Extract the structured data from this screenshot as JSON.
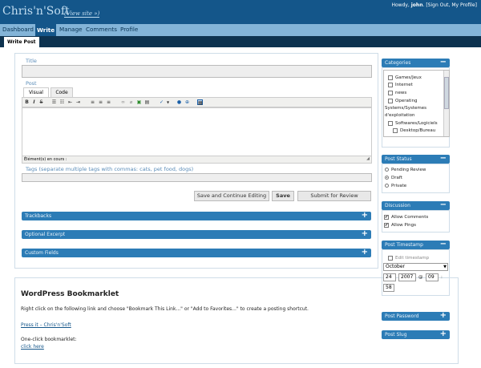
{
  "header": {
    "site_title": "Chris'n'Soft",
    "view_site": "(View site »)",
    "howdy": "Howdy, ",
    "user": "john",
    "sign_out": "[Sign Out",
    "my_profile": "My Profile]"
  },
  "menu": {
    "dashboard": "Dashboard",
    "write": "Write",
    "manage": "Manage",
    "comments": "Comments",
    "profile": "Profile"
  },
  "submenu": {
    "write_post": "Write Post"
  },
  "editor": {
    "title_label": "Title",
    "post_label": "Post",
    "tab_visual": "Visual",
    "tab_code": "Code",
    "status_path": "Élément(s) en cours :",
    "tags_label": "Tags (separate multiple tags with commas: cats, pet food, dogs)"
  },
  "buttons": {
    "save_continue": "Save and Continue Editing",
    "save": "Save",
    "submit_review": "Submit for Review"
  },
  "sections": {
    "trackbacks": "Trackbacks",
    "excerpt": "Optional Excerpt",
    "custom_fields": "Custom Fields"
  },
  "bookmarklet": {
    "heading": "WordPress Bookmarklet",
    "text": "Right click on the following link and choose \"Bookmark This Link...\" or \"Add to Favorites...\" to create a posting shortcut.",
    "press_link": "Press it – Chris'n'Soft",
    "one_click": "One-click bookmarklet:",
    "click_here": "click here"
  },
  "categories": {
    "title": "Categories",
    "items": [
      "Games/Jeux",
      "Internet",
      "news",
      "Operating",
      "Systems/Systemes",
      "d'exploitation",
      "Softwares/Logiciels",
      "Desktop/Bureau"
    ]
  },
  "post_status": {
    "title": "Post Status",
    "options": [
      "Pending Review",
      "Draft",
      "Private"
    ],
    "selected": "Draft"
  },
  "discussion": {
    "title": "Discussion",
    "allow_comments": "Allow Comments",
    "allow_pings": "Allow Pings"
  },
  "timestamp": {
    "title": "Post Timestamp",
    "edit": "Edit timestamp",
    "month": "October",
    "day": "24",
    "year": "2007",
    "at": "@",
    "hour": "09",
    "colon": ":",
    "minute": "58"
  },
  "post_password": {
    "title": "Post Password"
  },
  "post_slug": {
    "title": "Post Slug"
  },
  "icons": {
    "plus": "+",
    "minus": "−",
    "check": "✔"
  }
}
